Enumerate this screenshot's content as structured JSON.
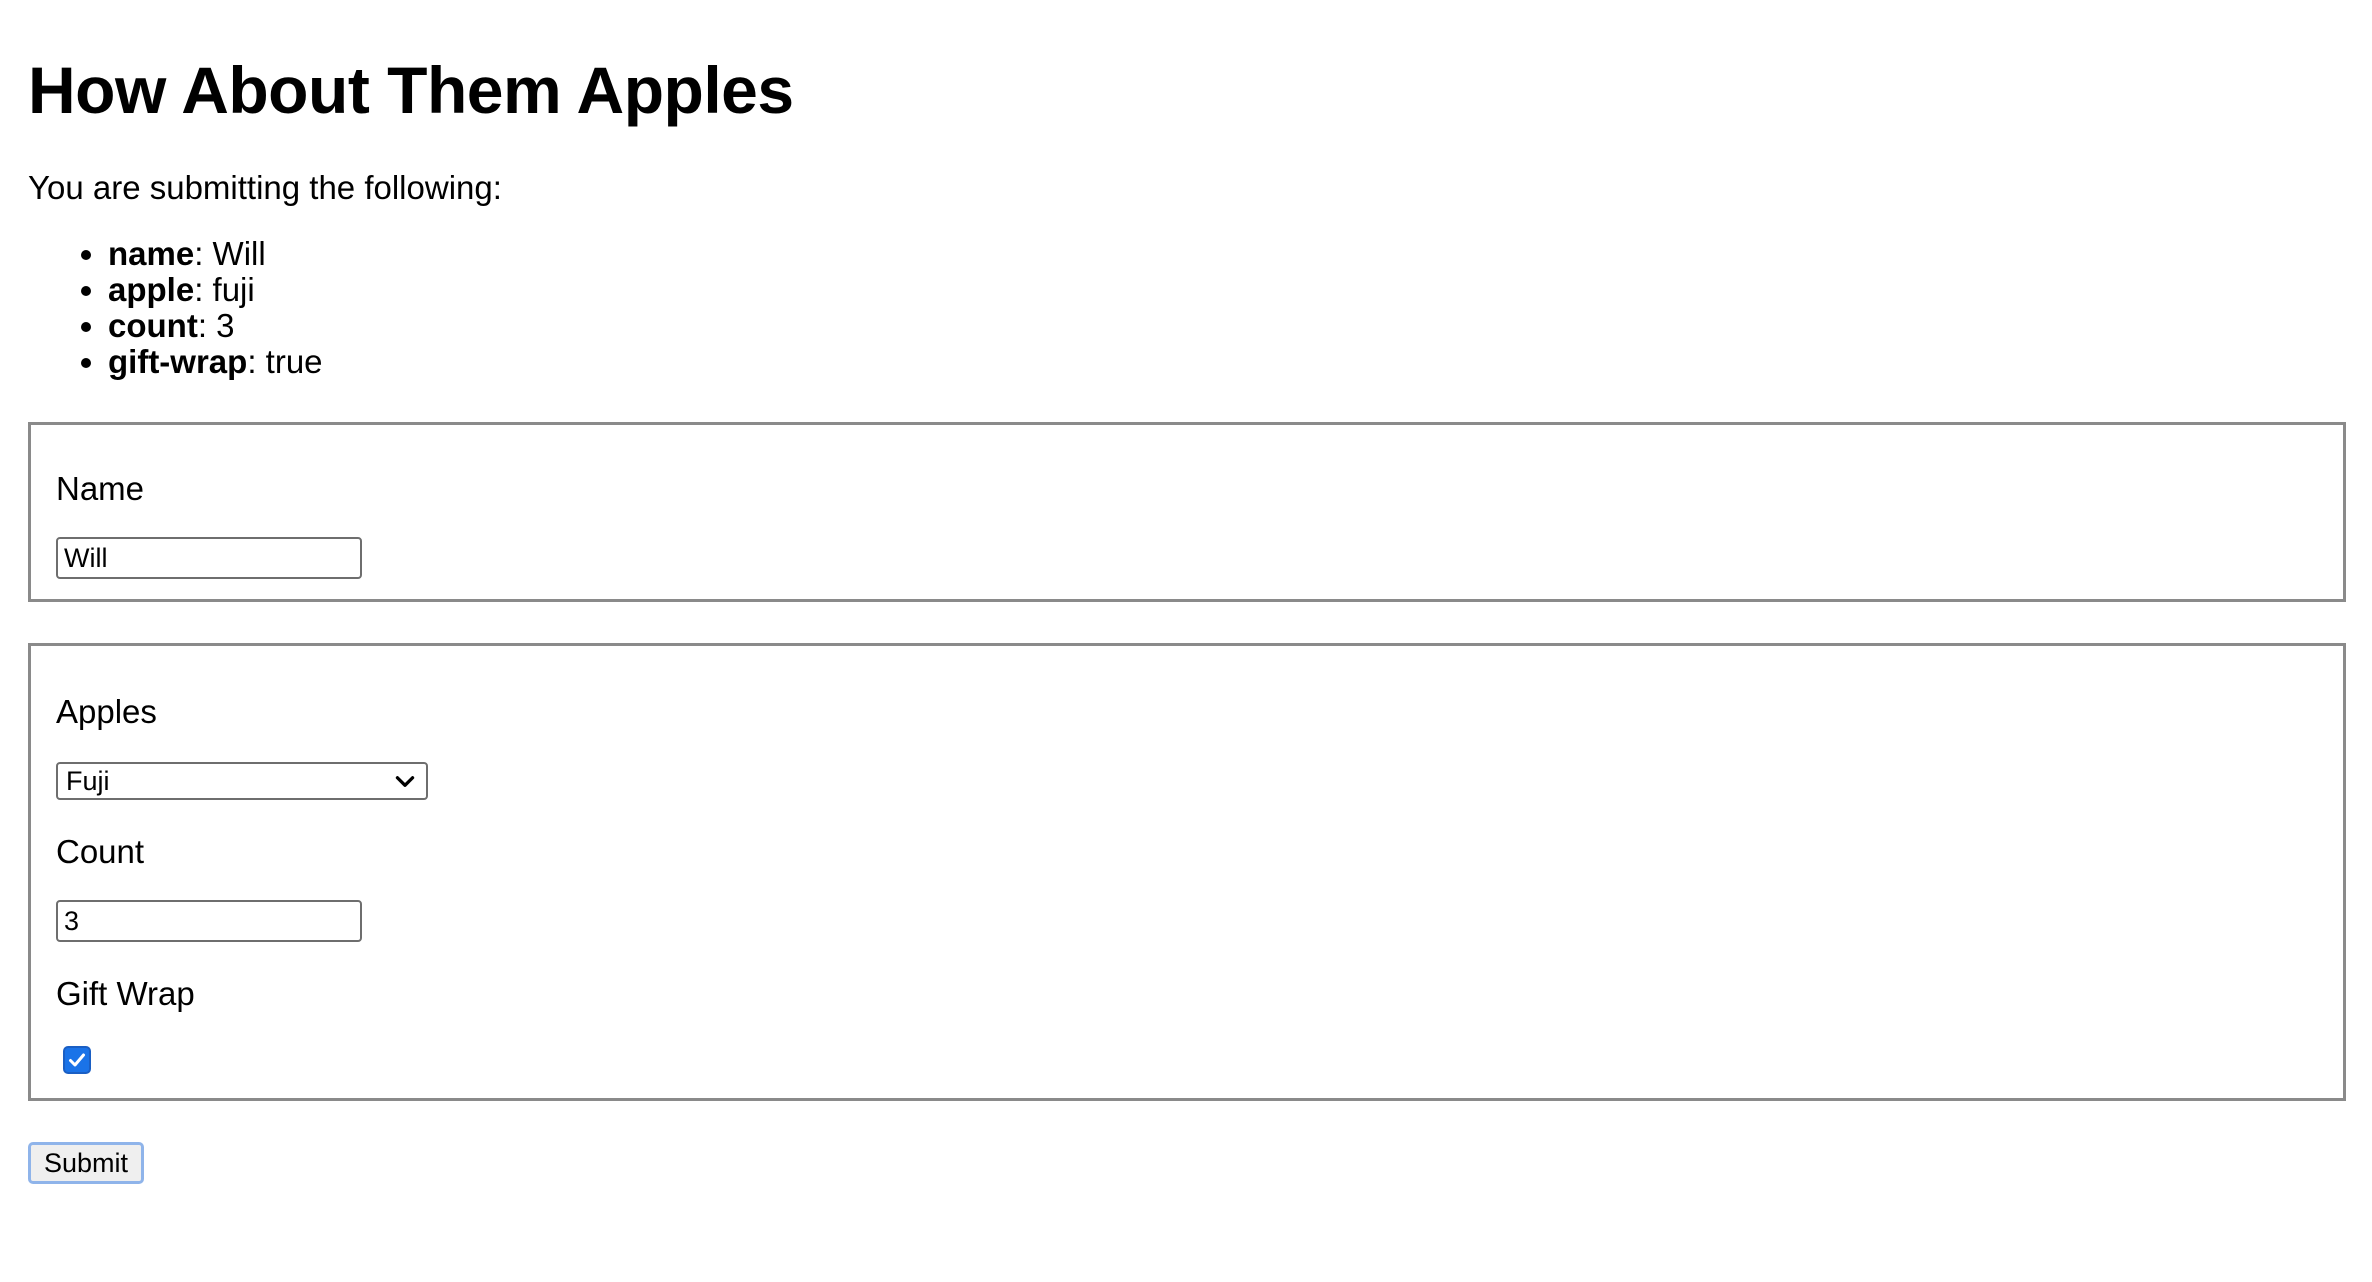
{
  "page": {
    "title": "How About Them Apples",
    "intro": "You are submitting the following:"
  },
  "summary": [
    {
      "key": "name",
      "value": ": Will"
    },
    {
      "key": "apple",
      "value": ": fuji"
    },
    {
      "key": "count",
      "value": ": 3"
    },
    {
      "key": "gift-wrap",
      "value": ": true"
    }
  ],
  "form": {
    "name_label": "Name",
    "name_value": "Will",
    "apples_label": "Apples",
    "apples_selected": "Fuji",
    "count_label": "Count",
    "count_value": "3",
    "giftwrap_label": "Gift Wrap",
    "giftwrap_checked": true,
    "submit_label": "Submit"
  },
  "colors": {
    "checkbox_accent": "#1a73e8",
    "submit_focus_ring": "#8fb4ea",
    "fieldset_border": "#8a8a8a"
  },
  "icons": {
    "select_arrow": "chevron-down-icon",
    "checkbox_mark": "checkmark-icon"
  }
}
